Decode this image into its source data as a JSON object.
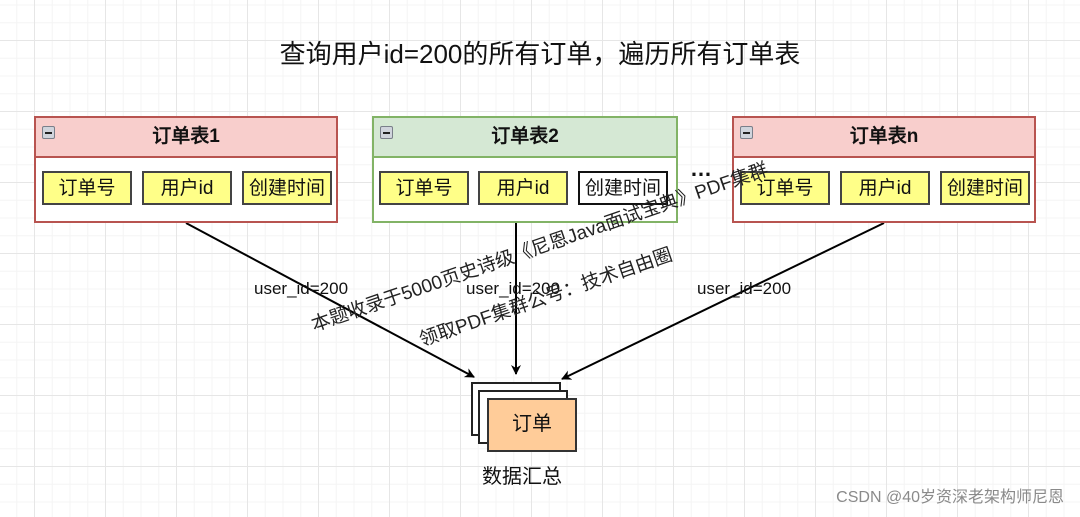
{
  "title": "查询用户id=200的所有订单，遍历所有订单表",
  "tables": [
    {
      "name": "订单表1",
      "color": "red",
      "fields": [
        {
          "label": "订单号",
          "style": "yellow"
        },
        {
          "label": "用户id",
          "style": "yellow"
        },
        {
          "label": "创建时间",
          "style": "yellow"
        }
      ]
    },
    {
      "name": "订单表2",
      "color": "green",
      "fields": [
        {
          "label": "订单号",
          "style": "yellow"
        },
        {
          "label": "用户id",
          "style": "yellow"
        },
        {
          "label": "创建时间",
          "style": "white"
        }
      ]
    },
    {
      "name": "订单表n",
      "color": "red",
      "fields": [
        {
          "label": "订单号",
          "style": "yellow"
        },
        {
          "label": "用户id",
          "style": "yellow"
        },
        {
          "label": "创建时间",
          "style": "yellow"
        }
      ]
    }
  ],
  "ellipsis": "…",
  "edges": [
    {
      "label": "user_id=200"
    },
    {
      "label": "user_id=200"
    },
    {
      "label": "user_id=200"
    }
  ],
  "target": {
    "label": "订单",
    "caption": "数据汇总"
  },
  "watermark": {
    "line1": "本题收录于5000页史诗级《尼恩Java面试宝典》PDF集群",
    "line2": "领取PDF集群公号：技术自由圈"
  },
  "credit": "CSDN @40岁资深老架构师尼恩",
  "colors": {
    "red_header": "#f8cecc",
    "red_border": "#b85450",
    "green_header": "#d5e8d4",
    "green_border": "#82b366",
    "field_yellow": "#ffff88",
    "target_fill": "#ffcc99"
  }
}
